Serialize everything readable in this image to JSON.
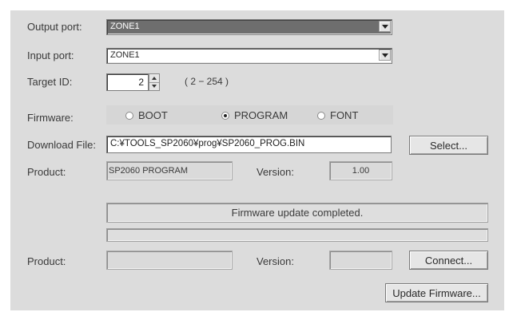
{
  "output_port": {
    "label": "Output port:",
    "value": "ZONE1"
  },
  "input_port": {
    "label": "Input port:",
    "value": "ZONE1"
  },
  "target_id": {
    "label": "Target ID:",
    "value": "2",
    "range": "( 2 − 254 )"
  },
  "firmware": {
    "label": "Firmware:",
    "options": [
      {
        "label": "BOOT",
        "checked": false
      },
      {
        "label": "PROGRAM",
        "checked": true
      },
      {
        "label": "FONT",
        "checked": false
      }
    ]
  },
  "download_file": {
    "label": "Download File:",
    "value": "C:¥TOOLS_SP2060¥prog¥SP2060_PROG.BIN",
    "select_button": "Select..."
  },
  "product_top": {
    "product_label": "Product:",
    "product_value": "SP2060 PROGRAM",
    "version_label": "Version:",
    "version_value": "1.00"
  },
  "status": {
    "message": "Firmware update completed.",
    "progress": 0
  },
  "product_bottom": {
    "product_label": "Product:",
    "product_value": "",
    "version_label": "Version:",
    "version_value": "",
    "connect_button": "Connect..."
  },
  "update_button": "Update Firmware..."
}
